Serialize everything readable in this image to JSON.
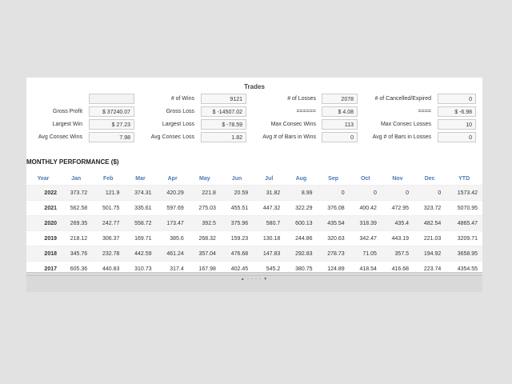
{
  "trades": {
    "title": "Trades",
    "rows": [
      [
        {
          "label": "",
          "value": ""
        },
        {
          "label": "# of Wins",
          "value": "9121"
        },
        {
          "label": "# of Losses",
          "value": "2078"
        },
        {
          "label": "# of Cancelled/Expired",
          "value": "0"
        }
      ],
      [
        {
          "label": "Gross Profit",
          "value": "$ 37240.07"
        },
        {
          "label": "Gross Loss",
          "value": "$ -14507.02"
        },
        {
          "label": "======",
          "value": "$ 4.08"
        },
        {
          "label": "====",
          "value": "$ -6.98"
        }
      ],
      [
        {
          "label": "Largest Win",
          "value": "$ 27.23"
        },
        {
          "label": "Largest Loss",
          "value": "$ -78.59"
        },
        {
          "label": "Max Consec Wins",
          "value": "113"
        },
        {
          "label": "Max Consec Losses",
          "value": "10"
        }
      ],
      [
        {
          "label": "Avg Consec Wins",
          "value": "7.98"
        },
        {
          "label": "Avg Consec Loss",
          "value": "1.82"
        },
        {
          "label": "Avg # of Bars in Wins",
          "value": "0"
        },
        {
          "label": "Avg # of Bars in Losses",
          "value": "0"
        }
      ]
    ]
  },
  "monthly": {
    "title": "MONTHLY PERFORMANCE ($)",
    "headers": [
      "Year",
      "Jan",
      "Feb",
      "Mar",
      "Apr",
      "May",
      "Jun",
      "Jul",
      "Aug",
      "Sep",
      "Oct",
      "Nov",
      "Dec",
      "YTD"
    ],
    "rows": [
      [
        "2022",
        "373.72",
        "121.9",
        "374.31",
        "420.29",
        "221.8",
        "20.59",
        "31.82",
        "8.99",
        "0",
        "0",
        "0",
        "0",
        "1573.42"
      ],
      [
        "2021",
        "562.58",
        "501.75",
        "335.61",
        "597.69",
        "275.03",
        "455.51",
        "447.32",
        "322.29",
        "376.08",
        "400.42",
        "472.95",
        "323.72",
        "5070.95"
      ],
      [
        "2020",
        "269.35",
        "242.77",
        "558.72",
        "173.47",
        "392.5",
        "375.96",
        "580.7",
        "600.13",
        "435.54",
        "318.39",
        "435.4",
        "482.54",
        "4865.47"
      ],
      [
        "2019",
        "218.12",
        "306.37",
        "169.71",
        "385.6",
        "268.32",
        "159.23",
        "130.18",
        "244.86",
        "320.63",
        "342.47",
        "443.19",
        "221.03",
        "3209.71"
      ],
      [
        "2018",
        "345.76",
        "232.78",
        "442.59",
        "461.24",
        "357.04",
        "476.68",
        "147.83",
        "292.83",
        "278.73",
        "71.05",
        "357.5",
        "194.92",
        "3658.95"
      ],
      [
        "2017",
        "605.36",
        "440.83",
        "310.73",
        "317.4",
        "167.98",
        "402.45",
        "545.2",
        "380.75",
        "124.89",
        "418.54",
        "416.68",
        "223.74",
        "4354.55"
      ]
    ]
  },
  "resize_handle": "▲ - - - - ▼"
}
